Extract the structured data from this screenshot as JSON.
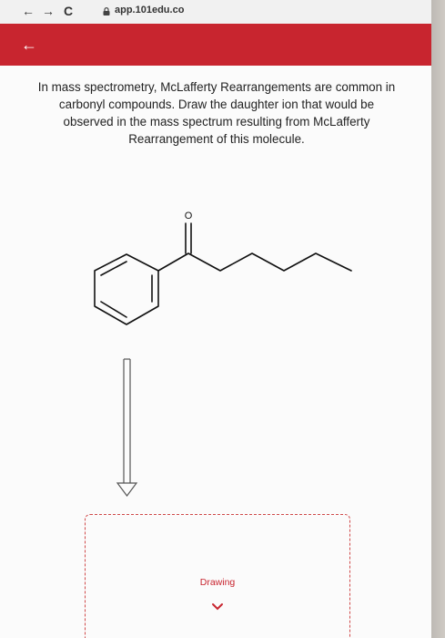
{
  "browser": {
    "back": "←",
    "forward": "→",
    "reload": "C",
    "url": "app.101edu.co"
  },
  "header": {
    "back": "←",
    "color": "#c8252f"
  },
  "question": {
    "text": "In mass spectrometry, McLafferty Rearrangements are common in carbonyl compounds. Draw the daughter ion that would be observed in the mass spectrum resulting from McLafferty Rearrangement of this molecule."
  },
  "molecule": {
    "oxygen_label": "O"
  },
  "drawing": {
    "label": "Drawing",
    "expand_icon": "chevron-down-icon"
  }
}
